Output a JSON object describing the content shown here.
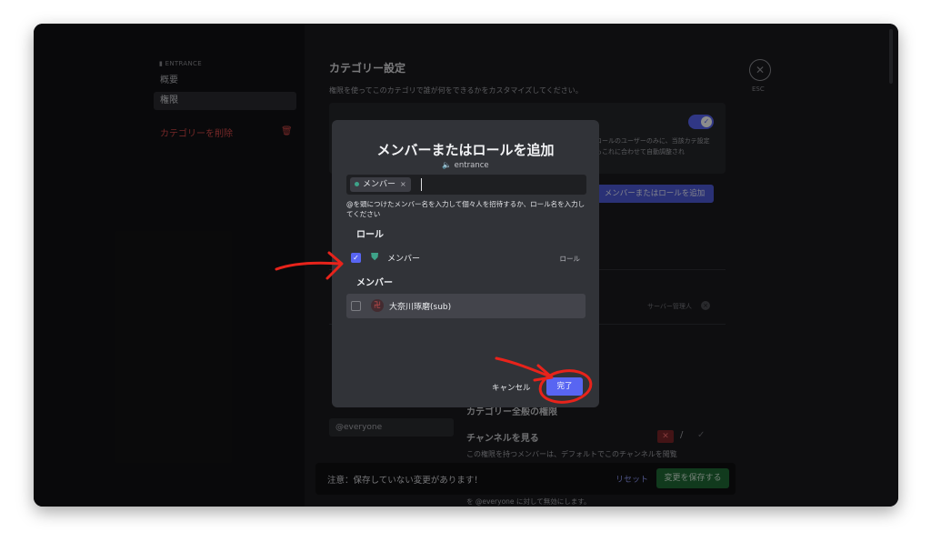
{
  "sidebar": {
    "category_label": "▮ ENTRANCE",
    "items": [
      {
        "label": "概要"
      },
      {
        "label": "権限"
      }
    ],
    "delete_label": "カテゴリーを削除"
  },
  "main": {
    "title": "カテゴリー設定",
    "subtitle": "権限を使ってこのカテゴリで誰が何をできるかをカスタマイズしてください。",
    "panel_text": "ロールのユーザーのみに、当該カテ設定もこれに合わせて自動調整され",
    "add_button": "メンバーまたはロールを追加",
    "admin_label": "サーバー管理人",
    "everyone": "@everyone",
    "category_perms": "カテゴリー全般の権限",
    "view_channel": "チャンネルを見る",
    "view_desc": "この権限を持つメンバーは、デフォルトでこのチャンネルを閲覧",
    "bottom_note": "を @everyone に対して無効にします。"
  },
  "save_bar": {
    "message": "注意：保存していない変更があります！",
    "reset": "リセット",
    "save": "変更を保存する"
  },
  "esc": {
    "label": "ESC"
  },
  "modal": {
    "title": "メンバーまたはロールを追加",
    "channel": "entrance",
    "selected_chip": "メンバー",
    "helper": "@を頭につけたメンバー名を入力して個々人を招待するか、ロール名を入力してください",
    "role_section": "ロール",
    "member_section": "メンバー",
    "role_row": {
      "name": "メンバー",
      "tag": "ロール",
      "checked": true
    },
    "member_row": {
      "name": "大奈川琢磨(sub)",
      "checked": false
    },
    "cancel": "キャンセル",
    "done": "完了"
  },
  "colors": {
    "accent": "#5865f2",
    "annotation": "#e8231b",
    "danger": "#d34848",
    "save_green": "#1f6a36"
  }
}
